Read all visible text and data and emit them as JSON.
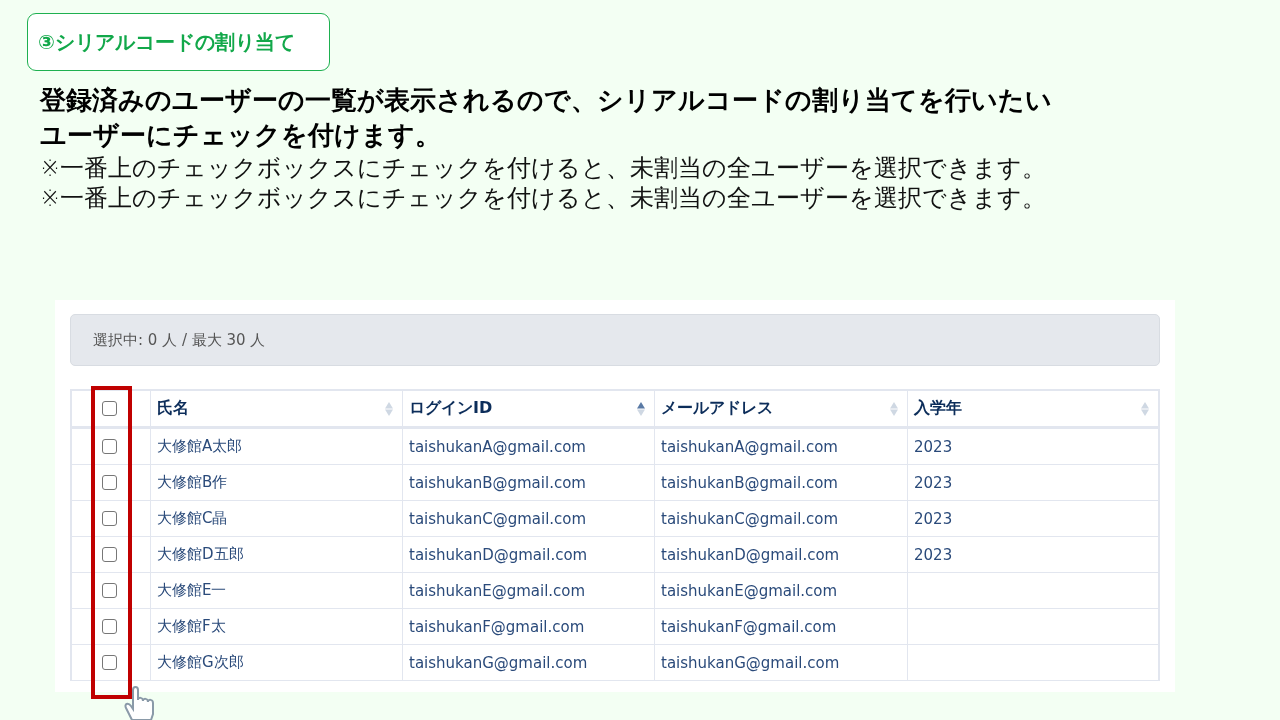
{
  "step_label": "③シリアルコードの割り当て",
  "heading": [
    "登録済みのユーザーの一覧が表示されるので、シリアルコードの割り当てを行いたい",
    "ユーザーにチェックを付けます。"
  ],
  "notes": [
    "※一番上のチェックボックスにチェックを付けると、未割当の全ユーザーを選択できます。",
    "※一番上のチェックボックスにチェックを付けると、未割当の全ユーザーを選択できます。"
  ],
  "screenshot": {
    "selection_status": "選択中: 0 人 / 最大 30 人",
    "table": {
      "select_all_checked": false,
      "columns": [
        {
          "label": "氏名",
          "sorted_ascending": false
        },
        {
          "label": "ログインID",
          "sorted_ascending": true
        },
        {
          "label": "メールアドレス",
          "sorted_ascending": false
        },
        {
          "label": "入学年",
          "sorted_ascending": false
        }
      ],
      "rows": [
        {
          "checked": false,
          "cells": [
            "大修館A太郎",
            "taishukanA@gmail.com",
            "taishukanA@gmail.com",
            "2023"
          ]
        },
        {
          "checked": false,
          "cells": [
            "大修館B作",
            "taishukanB@gmail.com",
            "taishukanB@gmail.com",
            "2023"
          ]
        },
        {
          "checked": false,
          "cells": [
            "大修館C晶",
            "taishukanC@gmail.com",
            "taishukanC@gmail.com",
            "2023"
          ]
        },
        {
          "checked": false,
          "cells": [
            "大修館D五郎",
            "taishukanD@gmail.com",
            "taishukanD@gmail.com",
            "2023"
          ]
        },
        {
          "checked": false,
          "cells": [
            "大修館E一",
            "taishukanE@gmail.com",
            "taishukanE@gmail.com"
          ]
        },
        {
          "checked": false,
          "cells": [
            "大修館F太",
            "taishukanF@gmail.com",
            "taishukanF@gmail.com"
          ]
        },
        {
          "checked": false,
          "cells": [
            "大修館G次郎",
            "taishukanG@gmail.com",
            "taishukanG@gmail.com"
          ]
        }
      ]
    }
  }
}
